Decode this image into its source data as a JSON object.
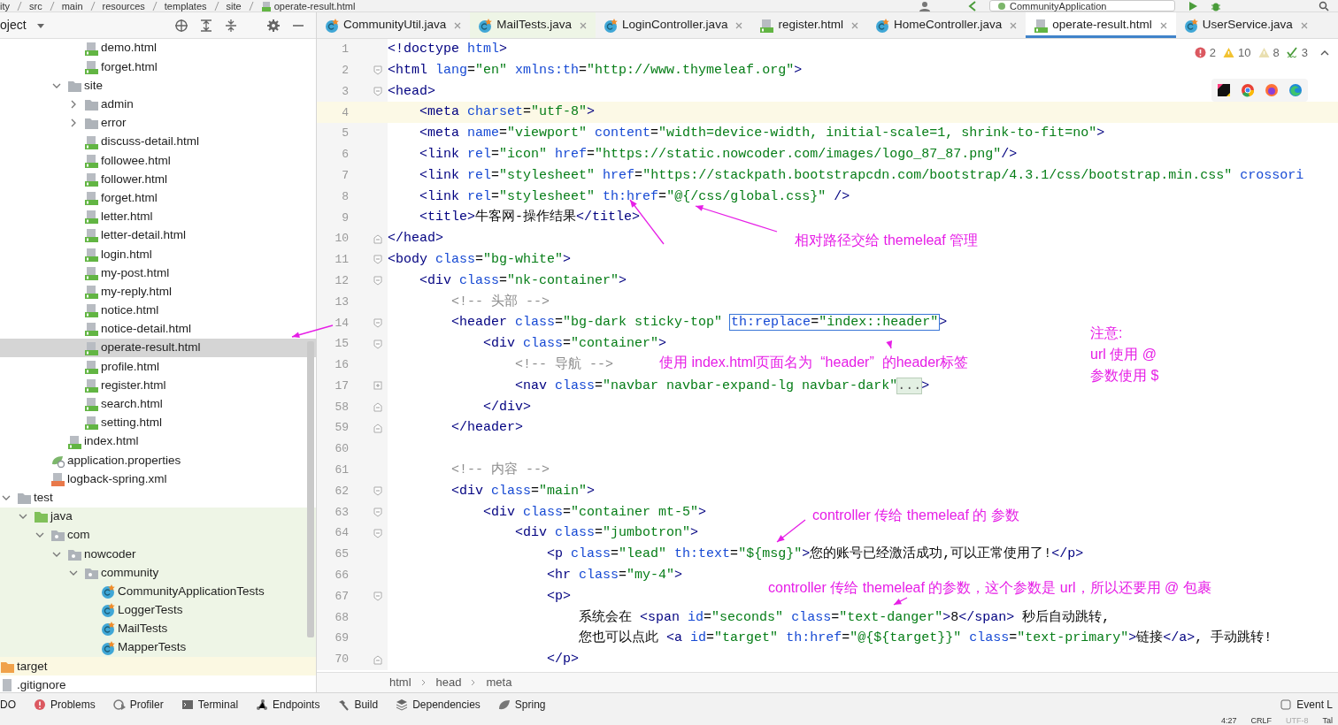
{
  "top_bar": {
    "breadcrumbs": [
      "ity",
      "src",
      "main",
      "resources",
      "templates",
      "site",
      "operate-result.html"
    ],
    "run_config": "CommunityApplication"
  },
  "project_panel": {
    "title": "oject",
    "tree": [
      {
        "children": [
          {
            "children": [
              {
                "children": [
                  {
                    "children": [
                      {
                        "children": [
                          {
                            "label": "demo.html",
                            "kind": "html",
                            "selected": false
                          },
                          {
                            "label": "forget.html",
                            "kind": "html",
                            "selected": false
                          }
                        ]
                      },
                      {
                        "label": "site",
                        "kind": "folder",
                        "expanded": true,
                        "selected": false,
                        "children": [
                          {
                            "label": "admin",
                            "kind": "folder",
                            "expanded": false,
                            "selected": false
                          },
                          {
                            "label": "error",
                            "kind": "folder",
                            "expanded": false,
                            "selected": false
                          },
                          {
                            "label": "discuss-detail.html",
                            "kind": "html",
                            "selected": false
                          },
                          {
                            "label": "followee.html",
                            "kind": "html",
                            "selected": false
                          },
                          {
                            "label": "follower.html",
                            "kind": "html",
                            "selected": false
                          },
                          {
                            "label": "forget.html",
                            "kind": "html",
                            "selected": false
                          },
                          {
                            "label": "letter.html",
                            "kind": "html",
                            "selected": false
                          },
                          {
                            "label": "letter-detail.html",
                            "kind": "html",
                            "selected": false
                          },
                          {
                            "label": "login.html",
                            "kind": "html",
                            "selected": false
                          },
                          {
                            "label": "my-post.html",
                            "kind": "html",
                            "selected": false
                          },
                          {
                            "label": "my-reply.html",
                            "kind": "html",
                            "selected": false
                          },
                          {
                            "label": "notice.html",
                            "kind": "html",
                            "selected": false
                          },
                          {
                            "label": "notice-detail.html",
                            "kind": "html",
                            "selected": false
                          },
                          {
                            "label": "operate-result.html",
                            "kind": "html",
                            "selected": true
                          },
                          {
                            "label": "profile.html",
                            "kind": "html",
                            "selected": false
                          },
                          {
                            "label": "register.html",
                            "kind": "html",
                            "selected": false
                          },
                          {
                            "label": "search.html",
                            "kind": "html",
                            "selected": false
                          },
                          {
                            "label": "setting.html",
                            "kind": "html",
                            "selected": false
                          }
                        ]
                      },
                      {
                        "label": "index.html",
                        "kind": "html",
                        "selected": false
                      }
                    ]
                  },
                  {
                    "label": "application.properties",
                    "kind": "properties",
                    "selected": false
                  },
                  {
                    "label": "logback-spring.xml",
                    "kind": "xml",
                    "selected": false
                  }
                ]
              }
            ]
          },
          {
            "label": "test",
            "kind": "folder",
            "expanded": true,
            "selected": false,
            "children": [
              {
                "label": "java",
                "kind": "test_source_folder",
                "expanded": true,
                "selected": false,
                "children": [
                  {
                    "label": "com",
                    "kind": "package",
                    "expanded": true,
                    "selected": false,
                    "children": [
                      {
                        "label": "nowcoder",
                        "kind": "package",
                        "expanded": true,
                        "selected": false,
                        "children": [
                          {
                            "label": "community",
                            "kind": "package",
                            "expanded": true,
                            "selected": false,
                            "children": [
                              {
                                "label": "CommunityApplicationTests",
                                "kind": "class",
                                "selected": false
                              },
                              {
                                "label": "LoggerTests",
                                "kind": "class",
                                "selected": false
                              },
                              {
                                "label": "MailTests",
                                "kind": "class",
                                "selected": false
                              },
                              {
                                "label": "MapperTests",
                                "kind": "class",
                                "selected": false
                              }
                            ]
                          }
                        ]
                      }
                    ]
                  }
                ]
              }
            ]
          }
        ]
      },
      {
        "label": "target",
        "kind": "excluded_folder",
        "selected": false
      },
      {
        "label": ".gitignore",
        "kind": "file",
        "selected": false
      }
    ]
  },
  "editor_tabs": [
    {
      "label": "CommunityUtil.java",
      "kind": "class",
      "selected": false
    },
    {
      "label": "MailTests.java",
      "kind": "test_class",
      "selected": false
    },
    {
      "label": "LoginController.java",
      "kind": "class",
      "selected": false
    },
    {
      "label": "register.html",
      "kind": "html",
      "selected": false
    },
    {
      "label": "HomeController.java",
      "kind": "class",
      "selected": false
    },
    {
      "label": "operate-result.html",
      "kind": "html",
      "selected": true
    },
    {
      "label": "UserService.java",
      "kind": "class",
      "selected": false
    }
  ],
  "inspections": {
    "errors": "2",
    "warnings": "10",
    "weak_warnings": "8",
    "typos": "3"
  },
  "code_lines": [
    {
      "number": "1",
      "kind": "plain",
      "current": false,
      "text": "<!doctype html>"
    },
    {
      "number": "2",
      "kind": "fold_start",
      "current": false,
      "text": "<html lang=\"en\" xmlns:th=\"http://www.thymeleaf.org\">"
    },
    {
      "number": "3",
      "kind": "fold_start",
      "current": false,
      "text": "<head>"
    },
    {
      "number": "4",
      "kind": "plain",
      "current": true,
      "text": "    <meta charset=\"utf-8\">"
    },
    {
      "number": "5",
      "kind": "plain",
      "current": false,
      "text": "    <meta name=\"viewport\" content=\"width=device-width, initial-scale=1, shrink-to-fit=no\">"
    },
    {
      "number": "6",
      "kind": "plain",
      "current": false,
      "text": "    <link rel=\"icon\" href=\"https://static.nowcoder.com/images/logo_87_87.png\"/>"
    },
    {
      "number": "7",
      "kind": "plain",
      "current": false,
      "text": "    <link rel=\"stylesheet\" href=\"https://stackpath.bootstrapcdn.com/bootstrap/4.3.1/css/bootstrap.min.css\" crossori"
    },
    {
      "number": "8",
      "kind": "plain",
      "current": false,
      "text": "    <link rel=\"stylesheet\" th:href=\"@{/css/global.css}\" />"
    },
    {
      "number": "9",
      "kind": "plain",
      "current": false,
      "text": "    <title>牛客网-操作结果</title>"
    },
    {
      "number": "10",
      "kind": "fold_end",
      "current": false,
      "text": "</head>"
    },
    {
      "number": "11",
      "kind": "fold_start",
      "current": false,
      "text": "<body class=\"bg-white\">"
    },
    {
      "number": "12",
      "kind": "fold_start",
      "current": false,
      "text": "    <div class=\"nk-container\">"
    },
    {
      "number": "13",
      "kind": "plain",
      "current": false,
      "text": "        <!-- 头部 -->"
    },
    {
      "number": "14",
      "kind": "fold_start",
      "current": false,
      "boxed": true,
      "text": "        <header class=\"bg-dark sticky-top\" th:replace=\"index::header\">"
    },
    {
      "number": "15",
      "kind": "fold_start",
      "current": false,
      "text": "            <div class=\"container\">"
    },
    {
      "number": "16",
      "kind": "plain",
      "current": false,
      "text": "                <!-- 导航 -->"
    },
    {
      "number": "17",
      "kind": "fold_collapsed",
      "current": false,
      "text": "                <nav class=\"navbar navbar-expand-lg navbar-dark\"...>"
    },
    {
      "number": "58",
      "kind": "fold_end",
      "current": false,
      "text": "            </div>"
    },
    {
      "number": "59",
      "kind": "fold_end",
      "current": false,
      "text": "        </header>"
    },
    {
      "number": "60",
      "kind": "plain",
      "current": false
    },
    {
      "number": "61",
      "kind": "plain",
      "current": false,
      "text": "        <!-- 内容 -->"
    },
    {
      "number": "62",
      "kind": "fold_start",
      "current": false,
      "text": "        <div class=\"main\">"
    },
    {
      "number": "63",
      "kind": "fold_start",
      "current": false,
      "text": "            <div class=\"container mt-5\">"
    },
    {
      "number": "64",
      "kind": "fold_start",
      "current": false,
      "text": "                <div class=\"jumbotron\">"
    },
    {
      "number": "65",
      "kind": "plain",
      "current": false,
      "text": "                    <p class=\"lead\" th:text=\"${msg}\">您的账号已经激活成功,可以正常使用了!</p>"
    },
    {
      "number": "66",
      "kind": "plain",
      "current": false,
      "text": "                    <hr class=\"my-4\">"
    },
    {
      "number": "67",
      "kind": "fold_start",
      "current": false,
      "text": "                    <p>"
    },
    {
      "number": "68",
      "kind": "plain",
      "current": false,
      "text": "                        系统会在 <span id=\"seconds\" class=\"text-danger\">8</span> 秒后自动跳转,"
    },
    {
      "number": "69",
      "kind": "plain",
      "current": false,
      "text": "                        您也可以点此 <a id=\"target\" th:href=\"@{${target}}\" class=\"text-primary\">链接</a>, 手动跳转!"
    },
    {
      "number": "70",
      "kind": "fold_end",
      "current": false,
      "text": "                    </p>"
    }
  ],
  "annotations": [
    "相对路径交给 themeleaf 管理",
    "注意:",
    "url 使用 @",
    "参数使用 $",
    "使用 index.html页面名为  “header”  的header标签",
    "controller 传给 themeleaf 的 参数",
    "controller 传给 themeleaf 的参数，这个参数是 url，所以还要用 @ 包裹"
  ],
  "editor_breadcrumb": [
    "html",
    "head",
    "meta"
  ],
  "tool_windows": [
    {
      "label": "DO",
      "kind": "todo"
    },
    {
      "label": "Problems",
      "kind": "problems"
    },
    {
      "label": "Profiler",
      "kind": "profiler"
    },
    {
      "label": "Terminal",
      "kind": "terminal"
    },
    {
      "label": "Endpoints",
      "kind": "endpoints"
    },
    {
      "label": "Build",
      "kind": "build"
    },
    {
      "label": "Dependencies",
      "kind": "dependencies"
    },
    {
      "label": "Spring",
      "kind": "spring"
    },
    {
      "label": "Event L",
      "kind": "event_log"
    }
  ],
  "status_bar": [
    {
      "text": "4:27",
      "disabled": false
    },
    {
      "text": "CRLF",
      "disabled": false
    },
    {
      "text": "UTF-8",
      "disabled": true
    },
    {
      "text": "Tal",
      "disabled": false
    }
  ]
}
